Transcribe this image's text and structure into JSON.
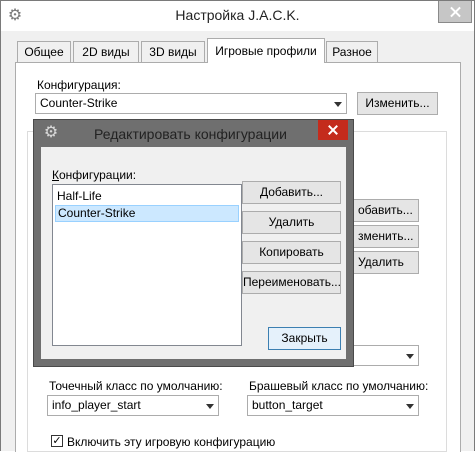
{
  "window": {
    "title": "Настройка J.A.C.K.",
    "colors": {
      "accent": "#0078d7",
      "dialog_frame": "#6f6f6f",
      "close_hover": "#c42b1c"
    }
  },
  "tabs": [
    {
      "label": "Общее"
    },
    {
      "label": "2D виды"
    },
    {
      "label": "3D виды"
    },
    {
      "label": "Игровые профили",
      "active": true
    },
    {
      "label": "Разное"
    }
  ],
  "config": {
    "label": "Конфигурация:",
    "selected": "Counter-Strike",
    "edit_button": "Изменить..."
  },
  "background_buttons": {
    "add": "обавить...",
    "edit": "зменить...",
    "delete": "Удалить"
  },
  "entity_classes": {
    "point_label": "Точечный класс по умолчанию:",
    "point_value": "info_player_start",
    "brush_label": "Брашевый класс по умолчанию:",
    "brush_value": "button_target"
  },
  "enable_checkbox": {
    "label": "Включить эту игровую конфигурацию",
    "checked": true
  },
  "dialog": {
    "title": "Редактировать конфигурации",
    "list_label": "Конфигурации:",
    "items": [
      "Half-Life",
      "Counter-Strike"
    ],
    "selected_index": 1,
    "buttons": {
      "add": "Добавить...",
      "delete": "Удалить",
      "copy": "Копировать",
      "rename": "Переименовать...",
      "close": "Закрыть"
    }
  }
}
